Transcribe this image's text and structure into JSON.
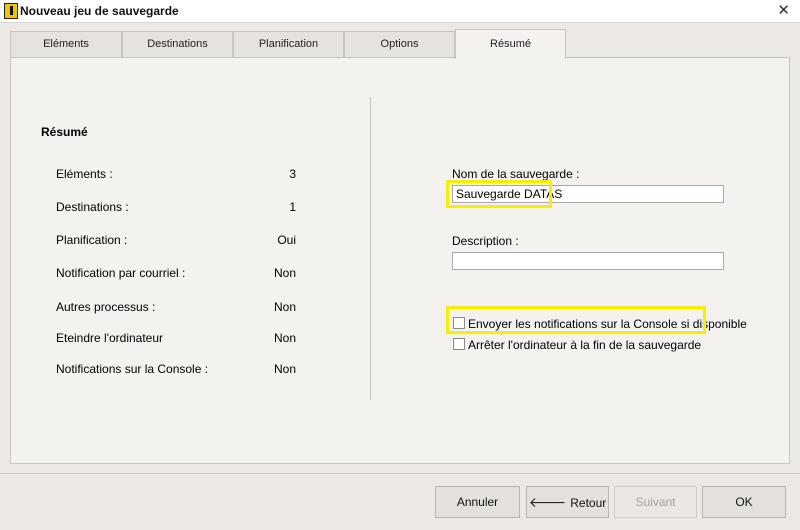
{
  "window": {
    "title": "Nouveau jeu de sauvegarde",
    "close_glyph": "✕"
  },
  "tabs": [
    {
      "label": "Eléments",
      "active": false
    },
    {
      "label": "Destinations",
      "active": false
    },
    {
      "label": "Planification",
      "active": false
    },
    {
      "label": "Options",
      "active": false
    },
    {
      "label": "Résumé",
      "active": true
    }
  ],
  "summary": {
    "title": "Résumé",
    "rows": [
      {
        "label": "Eléments :",
        "value": "3"
      },
      {
        "label": "Destinations :",
        "value": "1"
      },
      {
        "label": "Planification :",
        "value": "Oui"
      },
      {
        "label": "Notification par courriel :",
        "value": "Non"
      },
      {
        "label": "Autres processus :",
        "value": "Non"
      },
      {
        "label": "Eteindre l'ordinateur",
        "value": "Non"
      },
      {
        "label": "Notifications sur la Console :",
        "value": "Non"
      }
    ]
  },
  "form": {
    "name_label": "Nom de la sauvegarde :",
    "name_value": "Sauvegarde DATAS",
    "description_label": "Description :",
    "description_value": "",
    "checkbox_console": {
      "label": "Envoyer les notifications sur la Console si disponible",
      "checked": false
    },
    "checkbox_shutdown": {
      "label": "Arrêter l'ordinateur à la fin de la sauvegarde",
      "checked": false
    }
  },
  "buttons": {
    "cancel": "Annuler",
    "back": "Retour",
    "next": "Suivant",
    "ok": "OK"
  },
  "colors": {
    "highlight": "#f5ef00",
    "background": "#ece9e4",
    "panel": "#f4f2ef"
  }
}
